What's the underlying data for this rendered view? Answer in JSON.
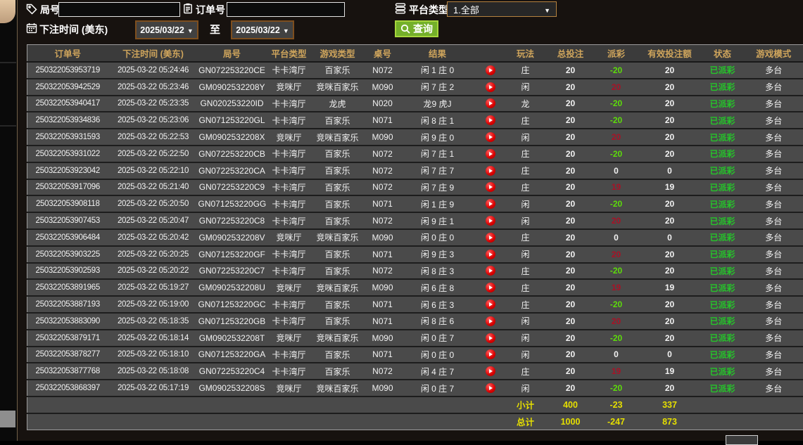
{
  "colors": {
    "header_text": "#cfa55c",
    "payout_negative": "#5ddc0a",
    "payout_positive": "#a81226",
    "status_paid": "#25c52a",
    "summary_text": "#e6df00",
    "search_button": "#74b02a",
    "date_border": "#7d4e1e",
    "row_background": "#4a4a4a"
  },
  "filters": {
    "round_label": "局号",
    "round_value": "",
    "order_label": "订单号",
    "order_value": "",
    "platform_label": "平台类型",
    "platform_value": "1.全部",
    "time_label": "下注时间 (美东)",
    "date_from": "2025/03/22",
    "to_label": "至",
    "date_to": "2025/03/22",
    "search_label": "查询"
  },
  "icons": [
    "tag-icon",
    "clipboard-icon",
    "list-icon",
    "calendar-icon",
    "magnifier-icon",
    "play-icon",
    "dropdown-arrow-icon"
  ],
  "table": {
    "headers": [
      "订单号",
      "下注时间 (美东)",
      "局号",
      "平台类型",
      "游戏类型",
      "桌号",
      "结果",
      "",
      "玩法",
      "总投注",
      "派彩",
      "有效投注额",
      "状态",
      "游戏模式"
    ],
    "rows": [
      {
        "order": "250322053953719",
        "time": "2025-03-22 05:24:46",
        "round": "GN072253220CE",
        "platform": "卡卡湾厅",
        "game": "百家乐",
        "table_no": "N072",
        "result": "闲 1 庄 0",
        "bet_on": "庄",
        "total": "20",
        "payout": "-20",
        "valid": "20",
        "status": "已派彩",
        "mode": "多台"
      },
      {
        "order": "250322053942529",
        "time": "2025-03-22 05:23:46",
        "round": "GM0902532208Y",
        "platform": "竞咪厅",
        "game": "竞咪百家乐",
        "table_no": "M090",
        "result": "闲 7 庄 2",
        "bet_on": "闲",
        "total": "20",
        "payout": "20",
        "valid": "20",
        "status": "已派彩",
        "mode": "多台"
      },
      {
        "order": "250322053940417",
        "time": "2025-03-22 05:23:35",
        "round": "GN020253220ID",
        "platform": "卡卡湾厅",
        "game": "龙虎",
        "table_no": "N020",
        "result": "龙9 虎J",
        "bet_on": "龙",
        "total": "20",
        "payout": "-20",
        "valid": "20",
        "status": "已派彩",
        "mode": "多台"
      },
      {
        "order": "250322053934836",
        "time": "2025-03-22 05:23:06",
        "round": "GN071253220GL",
        "platform": "卡卡湾厅",
        "game": "百家乐",
        "table_no": "N071",
        "result": "闲 8 庄 1",
        "bet_on": "庄",
        "total": "20",
        "payout": "-20",
        "valid": "20",
        "status": "已派彩",
        "mode": "多台"
      },
      {
        "order": "250322053931593",
        "time": "2025-03-22 05:22:53",
        "round": "GM0902532208X",
        "platform": "竞咪厅",
        "game": "竞咪百家乐",
        "table_no": "M090",
        "result": "闲 9 庄 0",
        "bet_on": "闲",
        "total": "20",
        "payout": "20",
        "valid": "20",
        "status": "已派彩",
        "mode": "多台"
      },
      {
        "order": "250322053931022",
        "time": "2025-03-22 05:22:50",
        "round": "GN072253220CB",
        "platform": "卡卡湾厅",
        "game": "百家乐",
        "table_no": "N072",
        "result": "闲 7 庄 1",
        "bet_on": "庄",
        "total": "20",
        "payout": "-20",
        "valid": "20",
        "status": "已派彩",
        "mode": "多台"
      },
      {
        "order": "250322053923042",
        "time": "2025-03-22 05:22:10",
        "round": "GN072253220CA",
        "platform": "卡卡湾厅",
        "game": "百家乐",
        "table_no": "N072",
        "result": "闲 7 庄 7",
        "bet_on": "庄",
        "total": "20",
        "payout": "0",
        "valid": "0",
        "status": "已派彩",
        "mode": "多台"
      },
      {
        "order": "250322053917096",
        "time": "2025-03-22 05:21:40",
        "round": "GN072253220C9",
        "platform": "卡卡湾厅",
        "game": "百家乐",
        "table_no": "N072",
        "result": "闲 7 庄 9",
        "bet_on": "庄",
        "total": "20",
        "payout": "19",
        "valid": "19",
        "status": "已派彩",
        "mode": "多台"
      },
      {
        "order": "250322053908118",
        "time": "2025-03-22 05:20:50",
        "round": "GN071253220GG",
        "platform": "卡卡湾厅",
        "game": "百家乐",
        "table_no": "N071",
        "result": "闲 1 庄 9",
        "bet_on": "闲",
        "total": "20",
        "payout": "-20",
        "valid": "20",
        "status": "已派彩",
        "mode": "多台"
      },
      {
        "order": "250322053907453",
        "time": "2025-03-22 05:20:47",
        "round": "GN072253220C8",
        "platform": "卡卡湾厅",
        "game": "百家乐",
        "table_no": "N072",
        "result": "闲 9 庄 1",
        "bet_on": "闲",
        "total": "20",
        "payout": "20",
        "valid": "20",
        "status": "已派彩",
        "mode": "多台"
      },
      {
        "order": "250322053906484",
        "time": "2025-03-22 05:20:42",
        "round": "GM0902532208V",
        "platform": "竞咪厅",
        "game": "竞咪百家乐",
        "table_no": "M090",
        "result": "闲 0 庄 0",
        "bet_on": "庄",
        "total": "20",
        "payout": "0",
        "valid": "0",
        "status": "已派彩",
        "mode": "多台"
      },
      {
        "order": "250322053903225",
        "time": "2025-03-22 05:20:25",
        "round": "GN071253220GF",
        "platform": "卡卡湾厅",
        "game": "百家乐",
        "table_no": "N071",
        "result": "闲 9 庄 3",
        "bet_on": "闲",
        "total": "20",
        "payout": "20",
        "valid": "20",
        "status": "已派彩",
        "mode": "多台"
      },
      {
        "order": "250322053902593",
        "time": "2025-03-22 05:20:22",
        "round": "GN072253220C7",
        "platform": "卡卡湾厅",
        "game": "百家乐",
        "table_no": "N072",
        "result": "闲 8 庄 3",
        "bet_on": "庄",
        "total": "20",
        "payout": "-20",
        "valid": "20",
        "status": "已派彩",
        "mode": "多台"
      },
      {
        "order": "250322053891965",
        "time": "2025-03-22 05:19:27",
        "round": "GM0902532208U",
        "platform": "竞咪厅",
        "game": "竞咪百家乐",
        "table_no": "M090",
        "result": "闲 6 庄 8",
        "bet_on": "庄",
        "total": "20",
        "payout": "19",
        "valid": "19",
        "status": "已派彩",
        "mode": "多台"
      },
      {
        "order": "250322053887193",
        "time": "2025-03-22 05:19:00",
        "round": "GN071253220GC",
        "platform": "卡卡湾厅",
        "game": "百家乐",
        "table_no": "N071",
        "result": "闲 6 庄 3",
        "bet_on": "庄",
        "total": "20",
        "payout": "-20",
        "valid": "20",
        "status": "已派彩",
        "mode": "多台"
      },
      {
        "order": "250322053883090",
        "time": "2025-03-22 05:18:35",
        "round": "GN071253220GB",
        "platform": "卡卡湾厅",
        "game": "百家乐",
        "table_no": "N071",
        "result": "闲 8 庄 6",
        "bet_on": "闲",
        "total": "20",
        "payout": "20",
        "valid": "20",
        "status": "已派彩",
        "mode": "多台"
      },
      {
        "order": "250322053879171",
        "time": "2025-03-22 05:18:14",
        "round": "GM0902532208T",
        "platform": "竞咪厅",
        "game": "竞咪百家乐",
        "table_no": "M090",
        "result": "闲 0 庄 7",
        "bet_on": "闲",
        "total": "20",
        "payout": "-20",
        "valid": "20",
        "status": "已派彩",
        "mode": "多台"
      },
      {
        "order": "250322053878277",
        "time": "2025-03-22 05:18:10",
        "round": "GN071253220GA",
        "platform": "卡卡湾厅",
        "game": "百家乐",
        "table_no": "N071",
        "result": "闲 0 庄 0",
        "bet_on": "闲",
        "total": "20",
        "payout": "0",
        "valid": "0",
        "status": "已派彩",
        "mode": "多台"
      },
      {
        "order": "250322053877768",
        "time": "2025-03-22 05:18:08",
        "round": "GN072253220C4",
        "platform": "卡卡湾厅",
        "game": "百家乐",
        "table_no": "N072",
        "result": "闲 4 庄 7",
        "bet_on": "庄",
        "total": "20",
        "payout": "19",
        "valid": "19",
        "status": "已派彩",
        "mode": "多台"
      },
      {
        "order": "250322053868397",
        "time": "2025-03-22 05:17:19",
        "round": "GM0902532208S",
        "platform": "竞咪厅",
        "game": "竞咪百家乐",
        "table_no": "M090",
        "result": "闲 0 庄 7",
        "bet_on": "闲",
        "total": "20",
        "payout": "-20",
        "valid": "20",
        "status": "已派彩",
        "mode": "多台"
      }
    ],
    "subtotal": {
      "label": "小计",
      "total": "400",
      "payout": "-23",
      "valid": "337"
    },
    "grand_total": {
      "label": "总计",
      "total": "1000",
      "payout": "-247",
      "valid": "873"
    }
  }
}
